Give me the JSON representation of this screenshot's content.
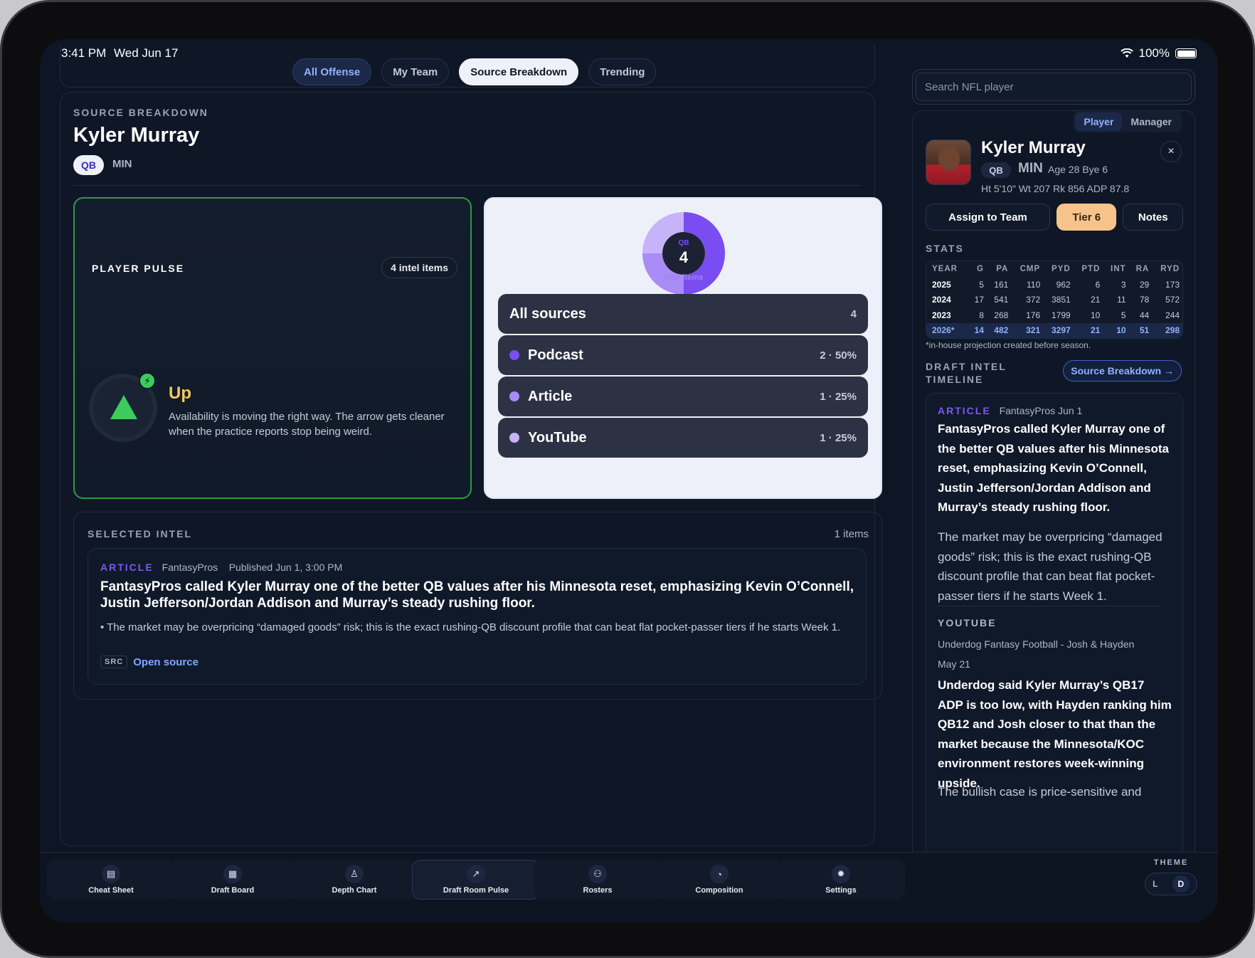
{
  "status": {
    "time": "3:41 PM",
    "date": "Wed Jun 17",
    "battery": "100%"
  },
  "top_tabs": [
    {
      "label": "All Offense",
      "state": "active-blue"
    },
    {
      "label": "My Team",
      "state": ""
    },
    {
      "label": "Source Breakdown",
      "state": "active-white"
    },
    {
      "label": "Trending",
      "state": ""
    }
  ],
  "main": {
    "eyebrow": "SOURCE BREAKDOWN",
    "player_name": "Kyler Murray",
    "position": "QB",
    "team": "MIN"
  },
  "pulse": {
    "label": "PLAYER PULSE",
    "count": "4 intel items",
    "direction": "Up",
    "description": "Availability is moving the right way. The arrow gets cleaner when the practice reports stop being weird.",
    "bolt": "⚡"
  },
  "sources": {
    "donut": {
      "top": "QB",
      "center": "4",
      "bottom": "intel items",
      "colors": [
        "#7a4df2",
        "#a98cf6",
        "#c6b3fa"
      ],
      "shares": [
        0.5,
        0.25,
        0.25
      ]
    },
    "rows": [
      {
        "name": "All sources",
        "value": "4",
        "dot": ""
      },
      {
        "name": "Podcast",
        "value": "2 · 50%",
        "dot": "#7a4df2"
      },
      {
        "name": "Article",
        "value": "1 · 25%",
        "dot": "#a98cf6"
      },
      {
        "name": "YouTube",
        "value": "1 · 25%",
        "dot": "#c6b3fa"
      }
    ]
  },
  "selected_intel": {
    "eyebrow": "SELECTED INTEL",
    "count": "1 items",
    "kind": "ARTICLE",
    "source": "FantasyPros",
    "published": "Published Jun 1, 3:00 PM",
    "headline": "FantasyPros called Kyler Murray one of the better QB values after his Minnesota reset, emphasizing Kevin O’Connell, Justin Jefferson/Jordan Addison and Murray’s steady rushing floor.",
    "body": "• The market may be overpricing “damaged goods” risk; this is the exact rushing-QB discount profile that can beat flat pocket-passer tiers if he starts Week 1.",
    "src_badge": "SRC",
    "link": "Open source"
  },
  "search": {
    "placeholder": "Search NFL player"
  },
  "side": {
    "seg": [
      "Player",
      "Manager"
    ],
    "name": "Kyler Murray",
    "position": "QB",
    "team": "MIN",
    "age_bye": "Age 28  Bye 6",
    "measurables": "Ht 5'10\"  Wt 207  Rk 856  ADP 87.8",
    "close": "×",
    "assign": "Assign to Team",
    "tier": "Tier 6",
    "notes": "Notes",
    "stats_label": "STATS",
    "stats_headers": [
      "YEAR",
      "G",
      "PA",
      "CMP",
      "PYD",
      "PTD",
      "INT",
      "RA",
      "RYD"
    ],
    "stats_rows": [
      [
        "2025",
        "5",
        "161",
        "110",
        "962",
        "6",
        "3",
        "29",
        "173"
      ],
      [
        "2024",
        "17",
        "541",
        "372",
        "3851",
        "21",
        "11",
        "78",
        "572"
      ],
      [
        "2023",
        "8",
        "268",
        "176",
        "1799",
        "10",
        "5",
        "44",
        "244"
      ],
      [
        "2026*",
        "14",
        "482",
        "321",
        "3297",
        "21",
        "10",
        "51",
        "298"
      ]
    ],
    "footnote": "*in-house projection created before season.",
    "timeline_label": "DRAFT INTEL TIMELINE",
    "source_breakdown_btn": "Source Breakdown →",
    "timeline": [
      {
        "kind": "ARTICLE",
        "meta": "FantasyPros   Jun 1",
        "headline": "FantasyPros called Kyler Murray one of the better QB values after his Minnesota reset, emphasizing Kevin O’Connell, Justin Jefferson/Jordan Addison and Murray’s steady rushing floor.",
        "body": "The market may be overpricing “damaged goods” risk; this is the exact rushing-QB discount profile that can beat flat pocket-passer tiers if he starts Week 1."
      },
      {
        "kind": "YOUTUBE",
        "meta": "Underdog Fantasy Football - Josh & Hayden",
        "date": "May 21",
        "headline": "Underdog said Kyler Murray’s QB17 ADP is too low, with Hayden ranking him QB12 and Josh closer to that than the market because the Minnesota/KOC environment restores week-winning upside.",
        "body": "The bullish case is price-sensitive and"
      }
    ]
  },
  "nav": [
    {
      "label": "Cheat Sheet",
      "icon": "▤",
      "icon_name": "cheat-sheet-icon"
    },
    {
      "label": "Draft Board",
      "icon": "▦",
      "icon_name": "draft-board-icon"
    },
    {
      "label": "Depth Chart",
      "icon": "♙",
      "icon_name": "depth-chart-icon"
    },
    {
      "label": "Draft Room Pulse",
      "icon": "↗",
      "icon_name": "trend-icon",
      "active": true
    },
    {
      "label": "Rosters",
      "icon": "⚇",
      "icon_name": "rosters-icon"
    },
    {
      "label": "Composition",
      "icon": "◔",
      "icon_name": "composition-icon"
    },
    {
      "label": "Settings",
      "icon": "✹",
      "icon_name": "settings-icon"
    }
  ],
  "theme": {
    "label": "THEME",
    "light": "L",
    "dark": "D"
  }
}
